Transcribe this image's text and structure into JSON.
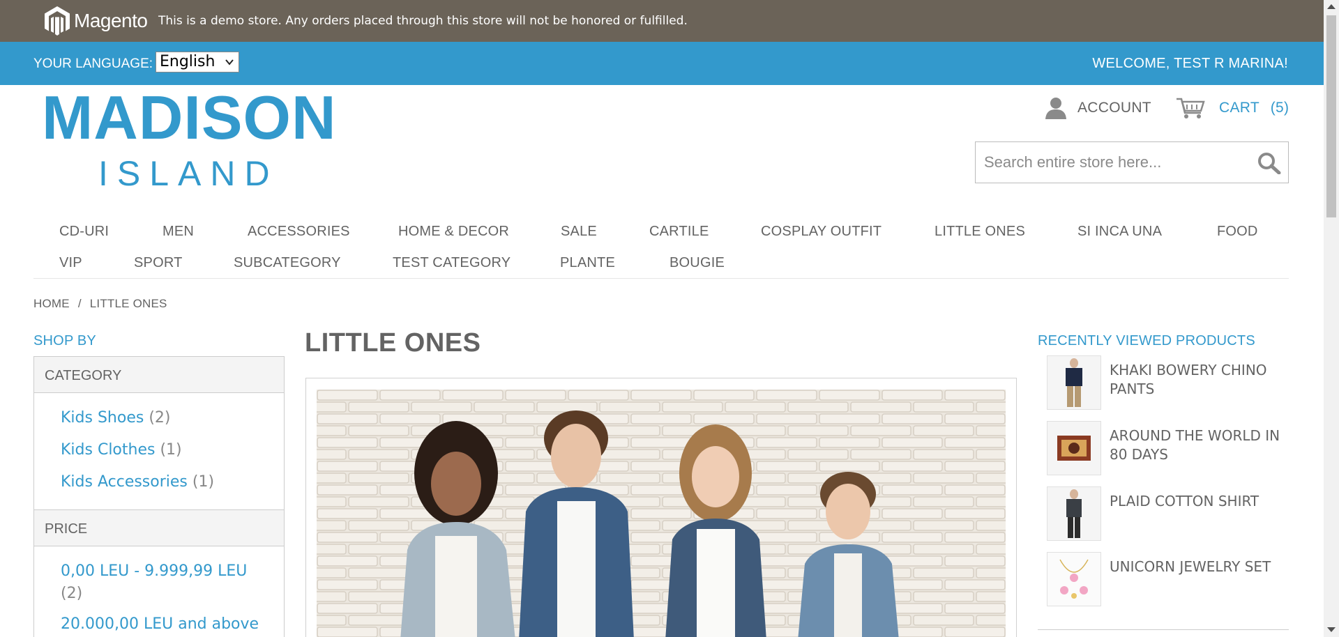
{
  "demo_notice": {
    "logo_text": "Magento",
    "message": "This is a demo store. Any orders placed through this store will not be honored or fulfilled."
  },
  "language_bar": {
    "label": "YOUR LANGUAGE:",
    "selected_language": "English",
    "welcome": "WELCOME, TEST R MARINA!"
  },
  "header": {
    "logo_main": "MADISON",
    "logo_sub": "ISLAND",
    "account_label": "ACCOUNT",
    "cart_label": "CART",
    "cart_count": "(5)",
    "search_placeholder": "Search entire store here..."
  },
  "nav": {
    "items": [
      "CD-URI",
      "MEN",
      "ACCESSORIES",
      "HOME & DECOR",
      "SALE",
      "CARTILE",
      "COSPLAY OUTFIT",
      "LITTLE ONES",
      "SI INCA UNA",
      "FOOD",
      "VIP",
      "SPORT",
      "SUBCATEGORY",
      "TEST CATEGORY",
      "PLANTE",
      "BOUGIE"
    ]
  },
  "breadcrumb": {
    "home": "HOME",
    "separator": "/",
    "current": "LITTLE ONES"
  },
  "sidebar": {
    "shop_by": "SHOP BY",
    "category_heading": "CATEGORY",
    "categories": [
      {
        "label": "Kids Shoes",
        "count": "(2)"
      },
      {
        "label": "Kids Clothes",
        "count": "(1)"
      },
      {
        "label": "Kids Accessories",
        "count": "(1)"
      }
    ],
    "price_heading": "PRICE",
    "prices": [
      {
        "label": "0,00 LEU - 9.999,99 LEU",
        "count": "(2)"
      },
      {
        "label": "20.000,00 LEU and above",
        "count": ""
      }
    ]
  },
  "main": {
    "page_title": "LITTLE ONES"
  },
  "recently_viewed": {
    "title": "RECENTLY VIEWED PRODUCTS",
    "items": [
      {
        "name": "KHAKI BOWERY CHINO PANTS"
      },
      {
        "name": "AROUND THE WORLD IN 80 DAYS"
      },
      {
        "name": "PLAID COTTON SHIRT"
      },
      {
        "name": "UNICORN JEWELRY SET"
      }
    ]
  },
  "colors": {
    "accent": "#3399cc",
    "demo_bar": "#6b6358",
    "text": "#636363"
  }
}
